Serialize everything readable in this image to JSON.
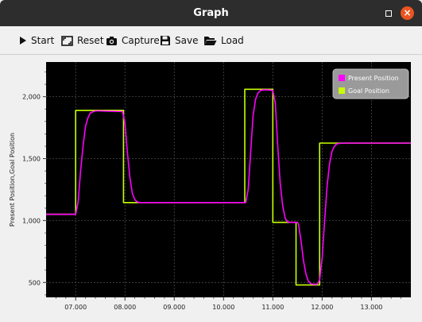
{
  "window": {
    "title": "Graph"
  },
  "toolbar": {
    "start_label": "Start",
    "reset_label": "Reset",
    "capture_label": "Capture",
    "save_label": "Save",
    "load_label": "Load"
  },
  "colors": {
    "present": "#ff00ff",
    "goal": "#c8ff00",
    "plot_bg": "#000000",
    "close_button": "#e95420"
  },
  "chart_data": {
    "type": "line",
    "ylabel": "Present Position,Goal Position",
    "xlabel": "",
    "xlim": [
      6.4,
      13.8
    ],
    "ylim": [
      380,
      2280
    ],
    "x_ticks": [
      "07.000",
      "08.000",
      "09.000",
      "10.000",
      "11.000",
      "12.000",
      "13.000"
    ],
    "y_ticks": [
      "500",
      "1,000",
      "1,500",
      "2,000"
    ],
    "grid": true,
    "legend_position": "top-right",
    "series": [
      {
        "name": "Present Position",
        "color": "#ff00ff",
        "x": [
          6.4,
          7.0,
          7.05,
          7.1,
          7.15,
          7.2,
          7.25,
          7.3,
          7.4,
          7.5,
          7.95,
          8.0,
          8.05,
          8.1,
          8.15,
          8.2,
          8.25,
          8.3,
          8.4,
          8.5,
          10.45,
          10.5,
          10.55,
          10.6,
          10.65,
          10.7,
          10.75,
          10.8,
          10.9,
          11.0,
          11.05,
          11.1,
          11.15,
          11.2,
          11.25,
          11.3,
          11.35,
          11.5,
          11.52,
          11.57,
          11.62,
          11.67,
          11.72,
          11.77,
          11.82,
          11.9,
          11.95,
          12.0,
          12.05,
          12.1,
          12.15,
          12.2,
          12.25,
          12.3,
          12.4,
          13.8
        ],
        "y": [
          1050,
          1050,
          1150,
          1400,
          1600,
          1760,
          1830,
          1870,
          1885,
          1885,
          1880,
          1790,
          1550,
          1350,
          1220,
          1170,
          1150,
          1145,
          1145,
          1145,
          1145,
          1250,
          1550,
          1850,
          1980,
          2030,
          2050,
          2055,
          2055,
          2050,
          1950,
          1600,
          1300,
          1120,
          1020,
          990,
          985,
          985,
          970,
          840,
          680,
          570,
          510,
          490,
          485,
          485,
          520,
          700,
          1000,
          1280,
          1460,
          1560,
          1600,
          1620,
          1625,
          1625
        ]
      },
      {
        "name": "Goal Position",
        "color": "#c8ff00",
        "x": [
          6.4,
          7.0,
          7.0,
          7.97,
          7.97,
          10.43,
          10.43,
          11.0,
          11.0,
          11.47,
          11.47,
          11.95,
          11.95,
          13.8
        ],
        "y": [
          1050,
          1050,
          1890,
          1890,
          1145,
          1145,
          2060,
          2060,
          985,
          985,
          480,
          480,
          1625,
          1625
        ]
      }
    ]
  }
}
